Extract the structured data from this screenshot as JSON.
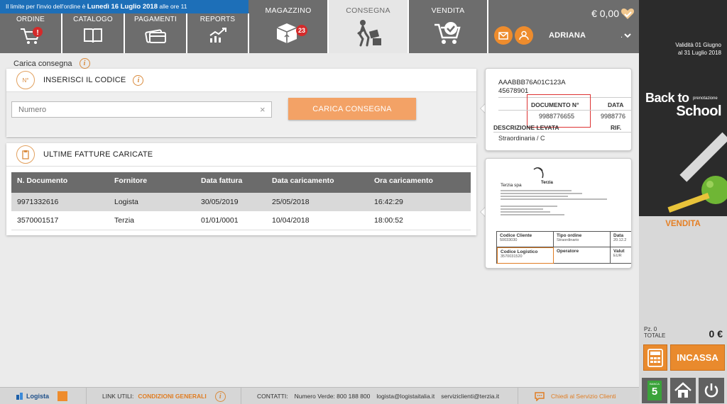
{
  "notice": {
    "prefix": "Il limite per l'invio dell'ordine è ",
    "day": "Lunedì 16 Luglio 2018",
    "suffix": " alle ore 11"
  },
  "nav_small": [
    {
      "label": "ORDINE",
      "icon": "cart-alert-icon"
    },
    {
      "label": "CATALOGO",
      "icon": "book-icon"
    },
    {
      "label": "PAGAMENTI",
      "icon": "cards-icon"
    },
    {
      "label": "REPORTS",
      "icon": "chart-up-icon"
    }
  ],
  "nav_big": [
    {
      "label": "MAGAZZINO",
      "icon": "box-icon",
      "badge": "23"
    },
    {
      "label": "CONSEGNA",
      "icon": "delivery-person-icon",
      "active": true
    },
    {
      "label": "VENDITA",
      "icon": "cart-check-icon"
    }
  ],
  "user": {
    "balance": "€ 0,00",
    "name": "ADRIANA",
    "dot": "."
  },
  "page": {
    "title": "Carica consegna"
  },
  "code_card": {
    "icon_text": "N°",
    "title": "INSERISCI IL CODICE",
    "placeholder": "Numero",
    "button": "CARICA CONSEGNA"
  },
  "invoices": {
    "title": "ULTIME FATTURE CARICATE",
    "columns": [
      "N. Documento",
      "Fornitore",
      "Data fattura",
      "Data caricamento",
      "Ora caricamento"
    ],
    "rows": [
      [
        "9971332616",
        "Logista",
        "30/05/2019",
        "25/05/2018",
        "16:42:29"
      ],
      [
        "3570001517",
        "Terzia",
        "01/01/0001",
        "10/04/2018",
        "18:00:52"
      ]
    ]
  },
  "doc1": {
    "code1": "AAABBB76A01C123A",
    "code2": "45678901",
    "doc_label": "DOCUMENTO N°",
    "date_label": "DATA",
    "doc_number": "9988776655",
    "date_value": "9988776",
    "desc_label": "DESCRIZIONE LEVATA",
    "rif_label": "RIF.",
    "desc_value": "Straordinaria / C"
  },
  "doc2": {
    "logo": "Terzia",
    "company": "Terzia spa",
    "codice_cliente": "Codice Cliente",
    "codice_cliente_val": "50033030",
    "tipo_ordine": "Tipo ordine",
    "tipo_ordine_val": "Straordinario",
    "data": "Data",
    "data_val": "20.12.2",
    "codice_logistico": "Codice Logistico",
    "codice_logistico_val": "3570031520",
    "operatore": "Operatore",
    "valuta": "Valut",
    "valuta_val": "EUR"
  },
  "promo": {
    "validity_1": "Validità 01 Giugno",
    "validity_2": "al 31 Luglio 2018",
    "line1": "Back to",
    "prenotazione": "prenotazione",
    "line2": "School"
  },
  "cart": {
    "tab": "VENDITA",
    "pz": "Pz. 0",
    "totale": "TOTALE",
    "total_value": "0 €",
    "incassa": "INCASSA",
    "banca": "BANCA",
    "banca_num": "5"
  },
  "footer": {
    "logista": "Logista",
    "link_utili": "LINK UTILI:",
    "condizioni": "CONDIZIONI GENERALI",
    "contatti": "CONTATTI:",
    "numero_verde": "Numero Verde: 800 188 800",
    "email1": "logista@logistaitalia.it",
    "email2": "serviziclienti@terzia.it",
    "chiedi": "Chiedi al Servizio Clienti"
  },
  "colors": {
    "accent": "#e98a2d",
    "nav": "#6d6d6d",
    "notice": "#1d6fb8"
  }
}
